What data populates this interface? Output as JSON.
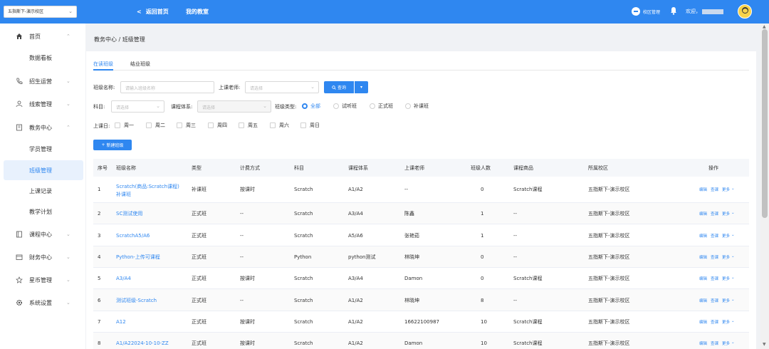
{
  "topbar": {
    "campus_select": "五指斯下-演示校区",
    "back_label": "返回首页",
    "my_classroom": "我的教室",
    "campus_mgmt": "校区管理",
    "welcome": "欢迎，"
  },
  "sidebar": {
    "items": [
      {
        "label": "首页",
        "icon": "home-icon"
      },
      {
        "label": "数据看板"
      },
      {
        "label": "招生运营",
        "icon": "phone-icon"
      },
      {
        "label": "线索管理",
        "icon": "user-icon"
      },
      {
        "label": "教务中心",
        "icon": "building-icon"
      },
      {
        "label": "学员管理"
      },
      {
        "label": "班级管理"
      },
      {
        "label": "上课记录"
      },
      {
        "label": "教学计划"
      },
      {
        "label": "课程中心",
        "icon": "book-icon"
      },
      {
        "label": "财务中心",
        "icon": "wallet-icon"
      },
      {
        "label": "星币管理",
        "icon": "star-icon"
      },
      {
        "label": "系统设置",
        "icon": "gear-icon"
      }
    ]
  },
  "breadcrumb": "教务中心 / 班级管理",
  "tabs": [
    "在读班级",
    "结业班级"
  ],
  "filters": {
    "class_name_label": "班级名称:",
    "class_name_placeholder": "请输入班级名称",
    "teacher_label": "上课老师:",
    "teacher_placeholder": "请选择",
    "query_label": "查询",
    "subject_label": "科目:",
    "subject_placeholder": "请选择",
    "system_label": "课程体系:",
    "system_placeholder": "请选择",
    "type_label": "班级类型:",
    "type_options": [
      "全部",
      "试听班",
      "正式班",
      "补课班"
    ],
    "day_label": "上课日:",
    "days": [
      "周一",
      "周二",
      "周三",
      "周四",
      "周五",
      "周六",
      "周日"
    ],
    "add_label": "新建班级"
  },
  "table": {
    "headers": [
      "序号",
      "班级名称",
      "类型",
      "计费方式",
      "科目",
      "课程体系",
      "上课老师",
      "班级人数",
      "课程商品",
      "所属校区",
      "操作"
    ],
    "rows": [
      {
        "no": "1",
        "name1": "Scratch(商品:Scratch课程)",
        "name2": "补课班",
        "type": "补课班",
        "billing": "按课时",
        "subject": "Scratch",
        "system": "A1/A2",
        "teacher": "--",
        "count": "0",
        "product": "Scratch课程",
        "campus": "五指斯下-演示校区"
      },
      {
        "no": "2",
        "name1": "SC测试使用",
        "name2": "",
        "type": "正式班",
        "billing": "--",
        "subject": "Scratch",
        "system": "A3/A4",
        "teacher": "陈鑫",
        "count": "1",
        "product": "--",
        "campus": "五指斯下-演示校区"
      },
      {
        "no": "3",
        "name1": "ScratchA5/A6",
        "name2": "",
        "type": "正式班",
        "billing": "--",
        "subject": "Scratch",
        "system": "A5/A6",
        "teacher": "张艳茹",
        "count": "1",
        "product": "--",
        "campus": "五指斯下-演示校区"
      },
      {
        "no": "4",
        "name1": "Python-上传可课程",
        "name2": "",
        "type": "正式班",
        "billing": "--",
        "subject": "Python",
        "system": "python测试",
        "teacher": "林晓坤",
        "count": "0",
        "product": "--",
        "campus": "五指斯下-演示校区"
      },
      {
        "no": "5",
        "name1": "A3/A4",
        "name2": "",
        "type": "正式班",
        "billing": "按课时",
        "subject": "Scratch",
        "system": "A3/A4",
        "teacher": "Damon",
        "count": "0",
        "product": "Scratch课程",
        "campus": "五指斯下-演示校区"
      },
      {
        "no": "6",
        "name1": "测试班级-Scratch",
        "name2": "",
        "type": "正式班",
        "billing": "--",
        "subject": "Scratch",
        "system": "A1/A2",
        "teacher": "林晓坤",
        "count": "8",
        "product": "--",
        "campus": "五指斯下-演示校区"
      },
      {
        "no": "7",
        "name1": "A12",
        "name2": "",
        "type": "正式班",
        "billing": "按课时",
        "subject": "Scratch",
        "system": "A1/A2",
        "teacher": "16622100987",
        "count": "10",
        "product": "Scratch课程",
        "campus": "五指斯下-演示校区"
      },
      {
        "no": "8",
        "name1": "A1/A22024-10-10-ZZ",
        "name2": "",
        "type": "正式班",
        "billing": "按课时",
        "subject": "Scratch",
        "system": "A1/A2",
        "teacher": "Damon",
        "count": "10",
        "product": "Scratch课程",
        "campus": "五指斯下-演示校区"
      }
    ],
    "ops": [
      "编辑",
      "查课",
      "更多"
    ]
  },
  "colors": {
    "primary": "#2f87f0",
    "bg": "#f0f2f5"
  }
}
